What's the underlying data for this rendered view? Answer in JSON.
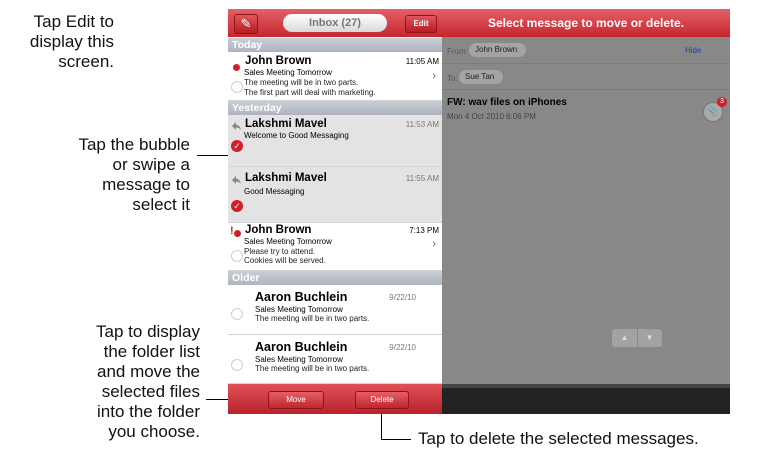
{
  "callouts": {
    "edit": [
      "Tap Edit to",
      "display this",
      "screen."
    ],
    "bubble": [
      "Tap the bubble",
      "or swipe a",
      "message to",
      "select it"
    ],
    "folder": [
      "Tap to display",
      "the folder list",
      "and move the",
      "selected files",
      "into the folder",
      "you choose."
    ],
    "delete": "Tap to delete the selected messages."
  },
  "list": {
    "inbox_title": "Inbox (27)",
    "edit_label": "Edit",
    "compose_icon": "compose-icon",
    "sections": [
      "Today",
      "Yesterday",
      "Older"
    ],
    "messages": [
      {
        "sender": "John Brown",
        "time": "11:05 AM",
        "subject": "Sales Meeting Tomorrow",
        "preview": [
          "The meeting will be in two parts.",
          "The first part will deal with marketing."
        ],
        "status": "unread",
        "selected": false
      },
      {
        "sender": "Lakshmi Mavel",
        "time": "11:53 AM",
        "subject": "Welcome to Good Messaging",
        "preview": [],
        "status": "replied",
        "selected": true
      },
      {
        "sender": "Lakshmi Mavel",
        "time": "11:55 AM",
        "subject": "Good Messaging",
        "preview": [],
        "status": "replied",
        "selected": true
      },
      {
        "sender": "John Brown",
        "time": "7:13 PM",
        "subject": "Sales Meeting Tomorrow",
        "preview": [
          "Please try to attend.",
          "Cookies will be served."
        ],
        "status": "important-unread",
        "selected": false
      },
      {
        "sender": "Aaron Buchlein",
        "time": "9/22/10",
        "subject": "Sales Meeting Tomorrow",
        "preview": [
          "The meeting will be in two parts."
        ],
        "status": "read",
        "selected": false
      },
      {
        "sender": "Aaron Buchlein",
        "time": "9/22/10",
        "subject": "Sales Meeting Tomorrow",
        "preview": [
          "The meeting will be in two parts."
        ],
        "status": "read",
        "selected": false
      }
    ],
    "move_label": "Move",
    "delete_label": "Delete"
  },
  "detail": {
    "header": "Select message to move or delete.",
    "from_label": "From:",
    "from_value": "John Brown",
    "to_label": "To:",
    "to_value": "Sue Tan",
    "hide_label": "Hide",
    "subject": "FW: wav files on iPhones",
    "date": "Mon 4 Oct 2010 6:06 PM",
    "attachment_count": "3",
    "colors": {
      "accent_red": "#c5262d",
      "dim_overlay": "#888888"
    }
  }
}
